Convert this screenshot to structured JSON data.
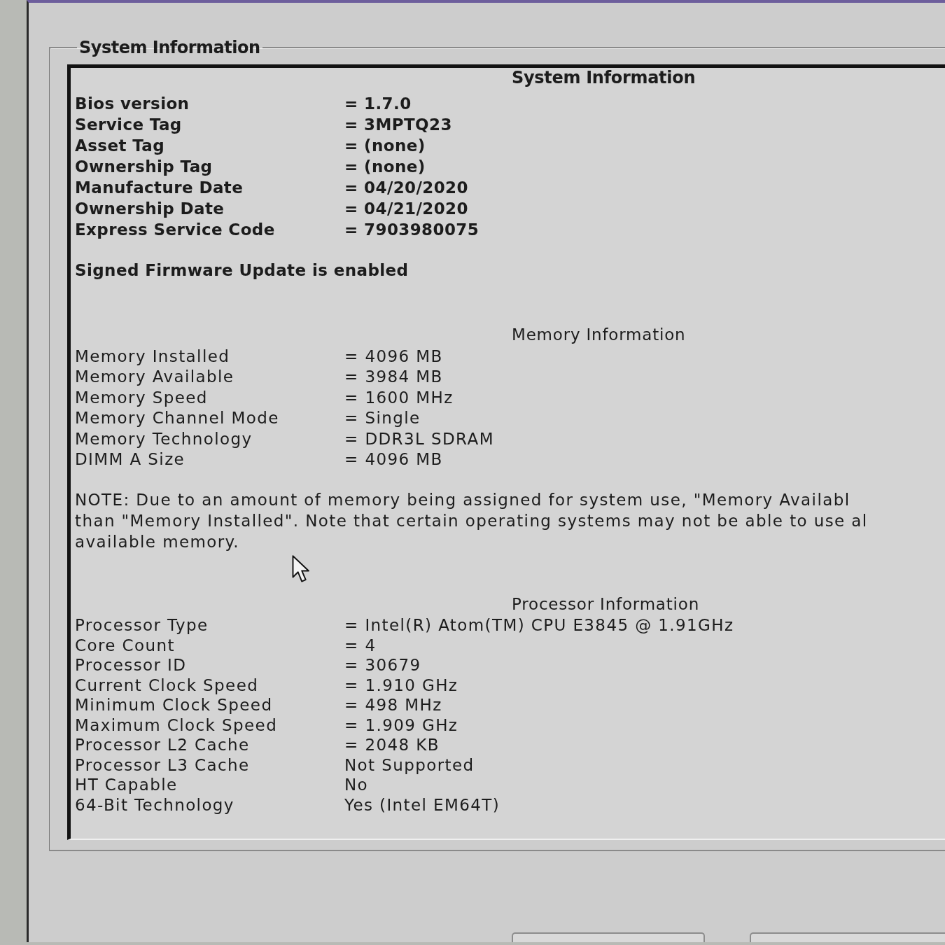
{
  "group_box": {
    "title": "System Information"
  },
  "sections": [
    {
      "title": "System Information",
      "rows": [
        {
          "label": "Bios version",
          "value": "= 1.7.0"
        },
        {
          "label": "Service Tag",
          "value": "= 3MPTQ23"
        },
        {
          "label": "Asset Tag",
          "value": "= (none)"
        },
        {
          "label": "Ownership Tag",
          "value": "= (none)"
        },
        {
          "label": "Manufacture Date",
          "value": "= 04/20/2020"
        },
        {
          "label": "Ownership Date",
          "value": "= 04/21/2020"
        },
        {
          "label": "Express Service Code",
          "value": "= 7903980075"
        }
      ],
      "note_lines": [
        "Signed Firmware Update is enabled"
      ]
    },
    {
      "title": "Memory Information",
      "rows": [
        {
          "label": "Memory Installed",
          "value": "= 4096 MB"
        },
        {
          "label": "Memory Available",
          "value": "= 3984 MB"
        },
        {
          "label": "Memory Speed",
          "value": "= 1600 MHz"
        },
        {
          "label": "Memory Channel Mode",
          "value": "= Single"
        },
        {
          "label": "Memory Technology",
          "value": "= DDR3L SDRAM"
        },
        {
          "label": "DIMM A Size",
          "value": "= 4096 MB"
        }
      ],
      "note_lines": [
        "NOTE: Due to an amount of memory being assigned for system use, \"Memory Availabl",
        "than \"Memory Installed\". Note that certain operating systems may not be able to use al",
        "available memory."
      ]
    },
    {
      "title": "Processor Information",
      "rows": [
        {
          "label": "Processor Type",
          "value": "= Intel(R) Atom(TM) CPU E3845 @ 1.91GHz"
        },
        {
          "label": "Core Count",
          "value": "= 4"
        },
        {
          "label": "Processor ID",
          "value": "= 30679"
        },
        {
          "label": "Current Clock Speed",
          "value": "= 1.910 GHz"
        },
        {
          "label": "Minimum Clock Speed",
          "value": "= 498 MHz"
        },
        {
          "label": "Maximum Clock Speed",
          "value": "= 1.909 GHz"
        },
        {
          "label": "Processor L2 Cache",
          "value": "= 2048 KB"
        },
        {
          "label": "Processor L3 Cache",
          "value": "Not Supported"
        },
        {
          "label": "HT Capable",
          "value": "No"
        },
        {
          "label": "64-Bit Technology",
          "value": "Yes (Intel EM64T)"
        }
      ]
    }
  ]
}
